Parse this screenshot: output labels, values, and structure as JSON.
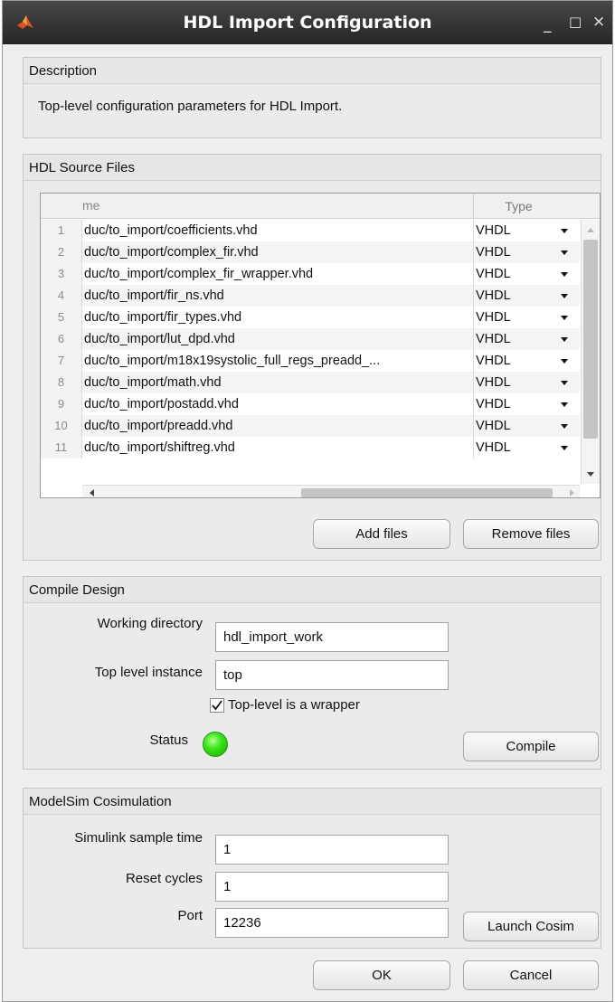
{
  "window": {
    "title": "HDL Import Configuration",
    "controls": {
      "minimize": "_",
      "maximize": "□",
      "close": "×"
    }
  },
  "description": {
    "header": "Description",
    "text": "Top-level configuration parameters for HDL Import."
  },
  "source_files": {
    "header": "HDL Source Files",
    "columns": {
      "name": "me",
      "type": "Type"
    },
    "rows": [
      {
        "num": "1",
        "name": "duc/to_import/coefficients.vhd",
        "type": "VHDL"
      },
      {
        "num": "2",
        "name": "duc/to_import/complex_fir.vhd",
        "type": "VHDL"
      },
      {
        "num": "3",
        "name": "duc/to_import/complex_fir_wrapper.vhd",
        "type": "VHDL"
      },
      {
        "num": "4",
        "name": "duc/to_import/fir_ns.vhd",
        "type": "VHDL"
      },
      {
        "num": "5",
        "name": "duc/to_import/fir_types.vhd",
        "type": "VHDL"
      },
      {
        "num": "6",
        "name": "duc/to_import/lut_dpd.vhd",
        "type": "VHDL"
      },
      {
        "num": "7",
        "name": "duc/to_import/m18x19systolic_full_regs_preadd_...",
        "type": "VHDL"
      },
      {
        "num": "8",
        "name": "duc/to_import/math.vhd",
        "type": "VHDL"
      },
      {
        "num": "9",
        "name": "duc/to_import/postadd.vhd",
        "type": "VHDL"
      },
      {
        "num": "10",
        "name": "duc/to_import/preadd.vhd",
        "type": "VHDL"
      },
      {
        "num": "11",
        "name": "duc/to_import/shiftreg.vhd",
        "type": "VHDL"
      }
    ],
    "add_button": "Add files",
    "remove_button": "Remove files"
  },
  "compile": {
    "header": "Compile Design",
    "working_dir_label": "Working directory",
    "working_dir_value": "hdl_import_work",
    "top_level_label": "Top level instance",
    "top_level_value": "top",
    "wrapper_checkbox_label": "Top-level is a wrapper",
    "wrapper_checked": true,
    "status_label": "Status",
    "status_color": "#2fd31a",
    "compile_button": "Compile"
  },
  "cosim": {
    "header": "ModelSim Cosimulation",
    "sample_time_label": "Simulink sample time",
    "sample_time_value": "1",
    "reset_cycles_label": "Reset cycles",
    "reset_cycles_value": "1",
    "port_label": "Port",
    "port_value": "12236",
    "launch_button": "Launch Cosim"
  },
  "footer": {
    "ok": "OK",
    "cancel": "Cancel"
  }
}
